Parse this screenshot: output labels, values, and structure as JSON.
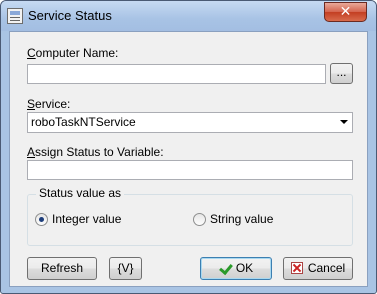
{
  "window": {
    "title": "Service Status",
    "close_glyph": "✕"
  },
  "computer_name": {
    "label_u": "C",
    "label_rest": "omputer Name:",
    "value": "",
    "browse_label": "..."
  },
  "service": {
    "label_u": "S",
    "label_rest": "ervice:",
    "selected": "roboTaskNTService"
  },
  "assign_variable": {
    "label_u": "A",
    "label_rest": "ssign Status to Variable:",
    "value": ""
  },
  "status_group": {
    "legend": "Status value as",
    "options": [
      {
        "label": "Integer value",
        "selected": true
      },
      {
        "label": "String value",
        "selected": false
      }
    ]
  },
  "buttons": {
    "refresh": "Refresh",
    "variable": "{V}",
    "ok": "OK",
    "cancel": "Cancel"
  },
  "icons": [
    "window-icon",
    "close-icon",
    "checkmark-icon",
    "cancel-x-icon",
    "dropdown-arrow-icon"
  ]
}
